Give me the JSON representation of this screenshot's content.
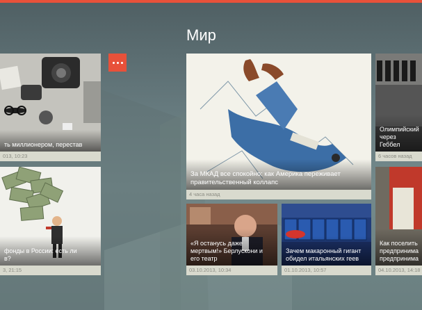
{
  "section": {
    "title": "Мир"
  },
  "toolbar": {
    "more_label": "•••"
  },
  "tiles": [
    {
      "id": "left-top",
      "headline": "ть миллионером, перестав",
      "meta": "013, 10:23"
    },
    {
      "id": "left-bottom",
      "headline": "фонды в России: есть ли\nв?",
      "meta": "3, 21:15"
    },
    {
      "id": "main",
      "headline": "За МКАД все спокойно: как Америка переживает правительственный коллапс",
      "meta": "4 часа назад"
    },
    {
      "id": "berlusconi",
      "headline": "«Я останусь даже мертвым!» Берлускони и его театр",
      "meta": "03.10.2013, 10:34"
    },
    {
      "id": "pasta",
      "headline": "Зачем макаронный гигант обидел итальянских геев",
      "meta": "01.10.2013, 10:57"
    },
    {
      "id": "olympics",
      "headline": "Олимпийский через Геббел",
      "meta": "6 часов назад"
    },
    {
      "id": "right-bottom",
      "headline": "Как поселить предпринима предпринима",
      "meta": "04.10.2013, 14:18"
    }
  ],
  "colors": {
    "accent": "#e8513a",
    "meta_bg": "#d9dace"
  }
}
